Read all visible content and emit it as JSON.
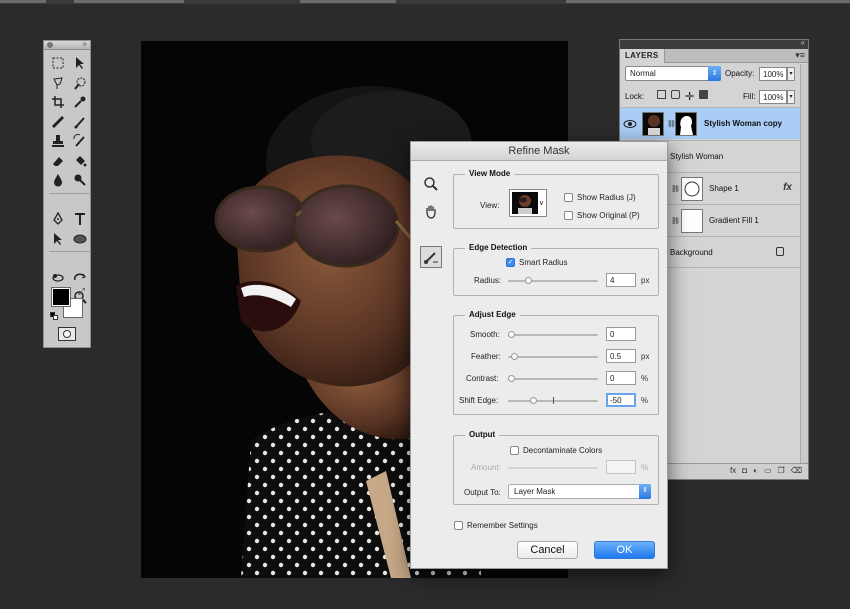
{
  "tools_panel": {
    "icons": [
      "marquee-icon",
      "move-icon",
      "lasso-icon",
      "quick-selection-icon",
      "crop-icon",
      "eyedropper-icon",
      "healing-brush-icon",
      "brush-icon",
      "clone-stamp-icon",
      "history-brush-icon",
      "eraser-icon",
      "paint-bucket-icon",
      "blur-icon",
      "dodge-icon",
      "pen-icon",
      "type-icon",
      "path-selection-icon",
      "ellipse-icon",
      "3d-rotate-icon",
      "3d-roll-icon",
      "hand-icon",
      "zoom-icon"
    ],
    "foreground_color": "#000000",
    "background_color": "#ffffff"
  },
  "layers_panel": {
    "tab_label": "LAYERS",
    "blend_mode": "Normal",
    "opacity_label": "Opacity:",
    "opacity_value": "100%",
    "lock_label": "Lock:",
    "fill_label": "Fill:",
    "fill_value": "100%",
    "layers": [
      {
        "name": "Stylish Woman copy",
        "selected": true
      },
      {
        "name": "Stylish Woman",
        "selected": false
      },
      {
        "name": "Shape 1",
        "selected": false
      },
      {
        "name": "Gradient Fill 1",
        "selected": false
      },
      {
        "name": "Background",
        "selected": false
      }
    ],
    "fx_label": "fx"
  },
  "refine_mask": {
    "title": "Refine Mask",
    "view_mode": {
      "label": "View Mode",
      "view_label": "View:",
      "show_radius": "Show Radius (J)",
      "show_original": "Show Original (P)"
    },
    "edge_detection": {
      "label": "Edge Detection",
      "smart_radius": "Smart Radius",
      "radius_label": "Radius:",
      "radius_value": "4",
      "radius_unit": "px"
    },
    "adjust_edge": {
      "label": "Adjust Edge",
      "smooth_label": "Smooth:",
      "smooth_value": "0",
      "feather_label": "Feather:",
      "feather_value": "0.5",
      "feather_unit": "px",
      "contrast_label": "Contrast:",
      "contrast_value": "0",
      "contrast_unit": "%",
      "shift_label": "Shift Edge:",
      "shift_value": "-50",
      "shift_unit": "%"
    },
    "output": {
      "label": "Output",
      "decontaminate": "Decontaminate Colors",
      "amount_label": "Amount:",
      "amount_unit": "%",
      "output_to_label": "Output To:",
      "output_to_value": "Layer Mask"
    },
    "remember_settings": "Remember Settings",
    "cancel_label": "Cancel",
    "ok_label": "OK",
    "accent_color": "#2a7ff0"
  }
}
